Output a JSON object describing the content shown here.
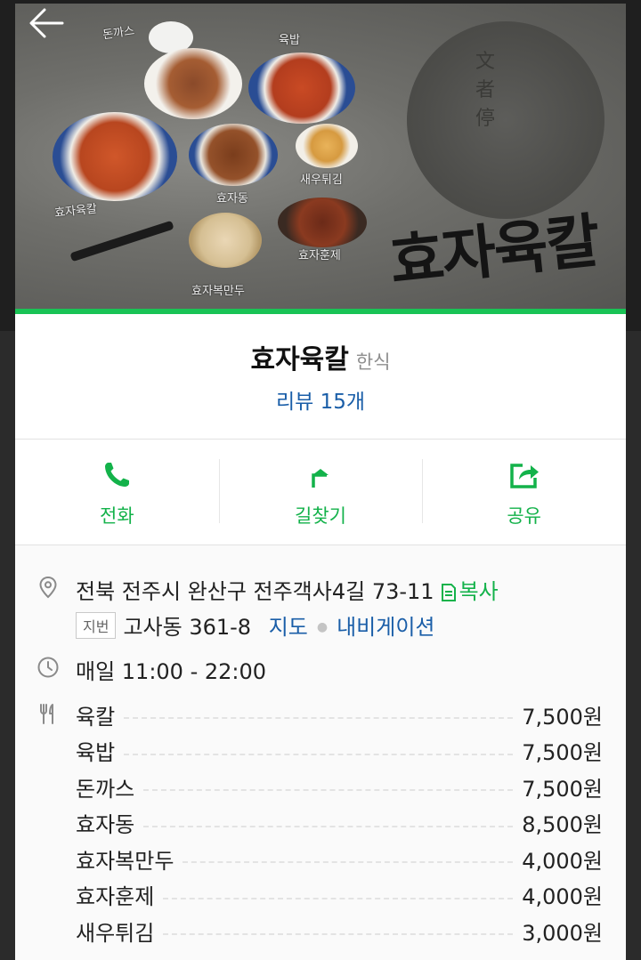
{
  "hero": {
    "dish_labels": [
      "돈까스",
      "육밥",
      "효자육칼",
      "효자동",
      "새우튀김",
      "효자훈제",
      "효자복만두"
    ],
    "brand_vertical": "文者停",
    "brand_script": "효자육칼"
  },
  "place": {
    "name": "효자육칼",
    "category": "한식",
    "review_link": "리뷰 15개"
  },
  "actions": [
    {
      "label": "전화",
      "icon": "phone-icon"
    },
    {
      "label": "길찾기",
      "icon": "directions-icon"
    },
    {
      "label": "공유",
      "icon": "share-icon"
    }
  ],
  "address": {
    "road": "전북 전주시 완산구 전주객사4길 73-11",
    "copy_label": "복사",
    "jibun_tag": "지번",
    "jibun": "고사동 361-8",
    "map_link": "지도",
    "nav_link": "내비게이션"
  },
  "hours": "매일 11:00 - 22:00",
  "menu": [
    {
      "name": "육칼",
      "price": "7,500원"
    },
    {
      "name": "육밥",
      "price": "7,500원"
    },
    {
      "name": "돈까스",
      "price": "7,500원"
    },
    {
      "name": "효자동",
      "price": "8,500원"
    },
    {
      "name": "효자복만두",
      "price": "4,000원"
    },
    {
      "name": "효자훈제",
      "price": "4,000원"
    },
    {
      "name": "새우튀김",
      "price": "3,000원"
    }
  ],
  "colors": {
    "accent_green": "#13b24a",
    "link_blue": "#1a5ea8"
  }
}
